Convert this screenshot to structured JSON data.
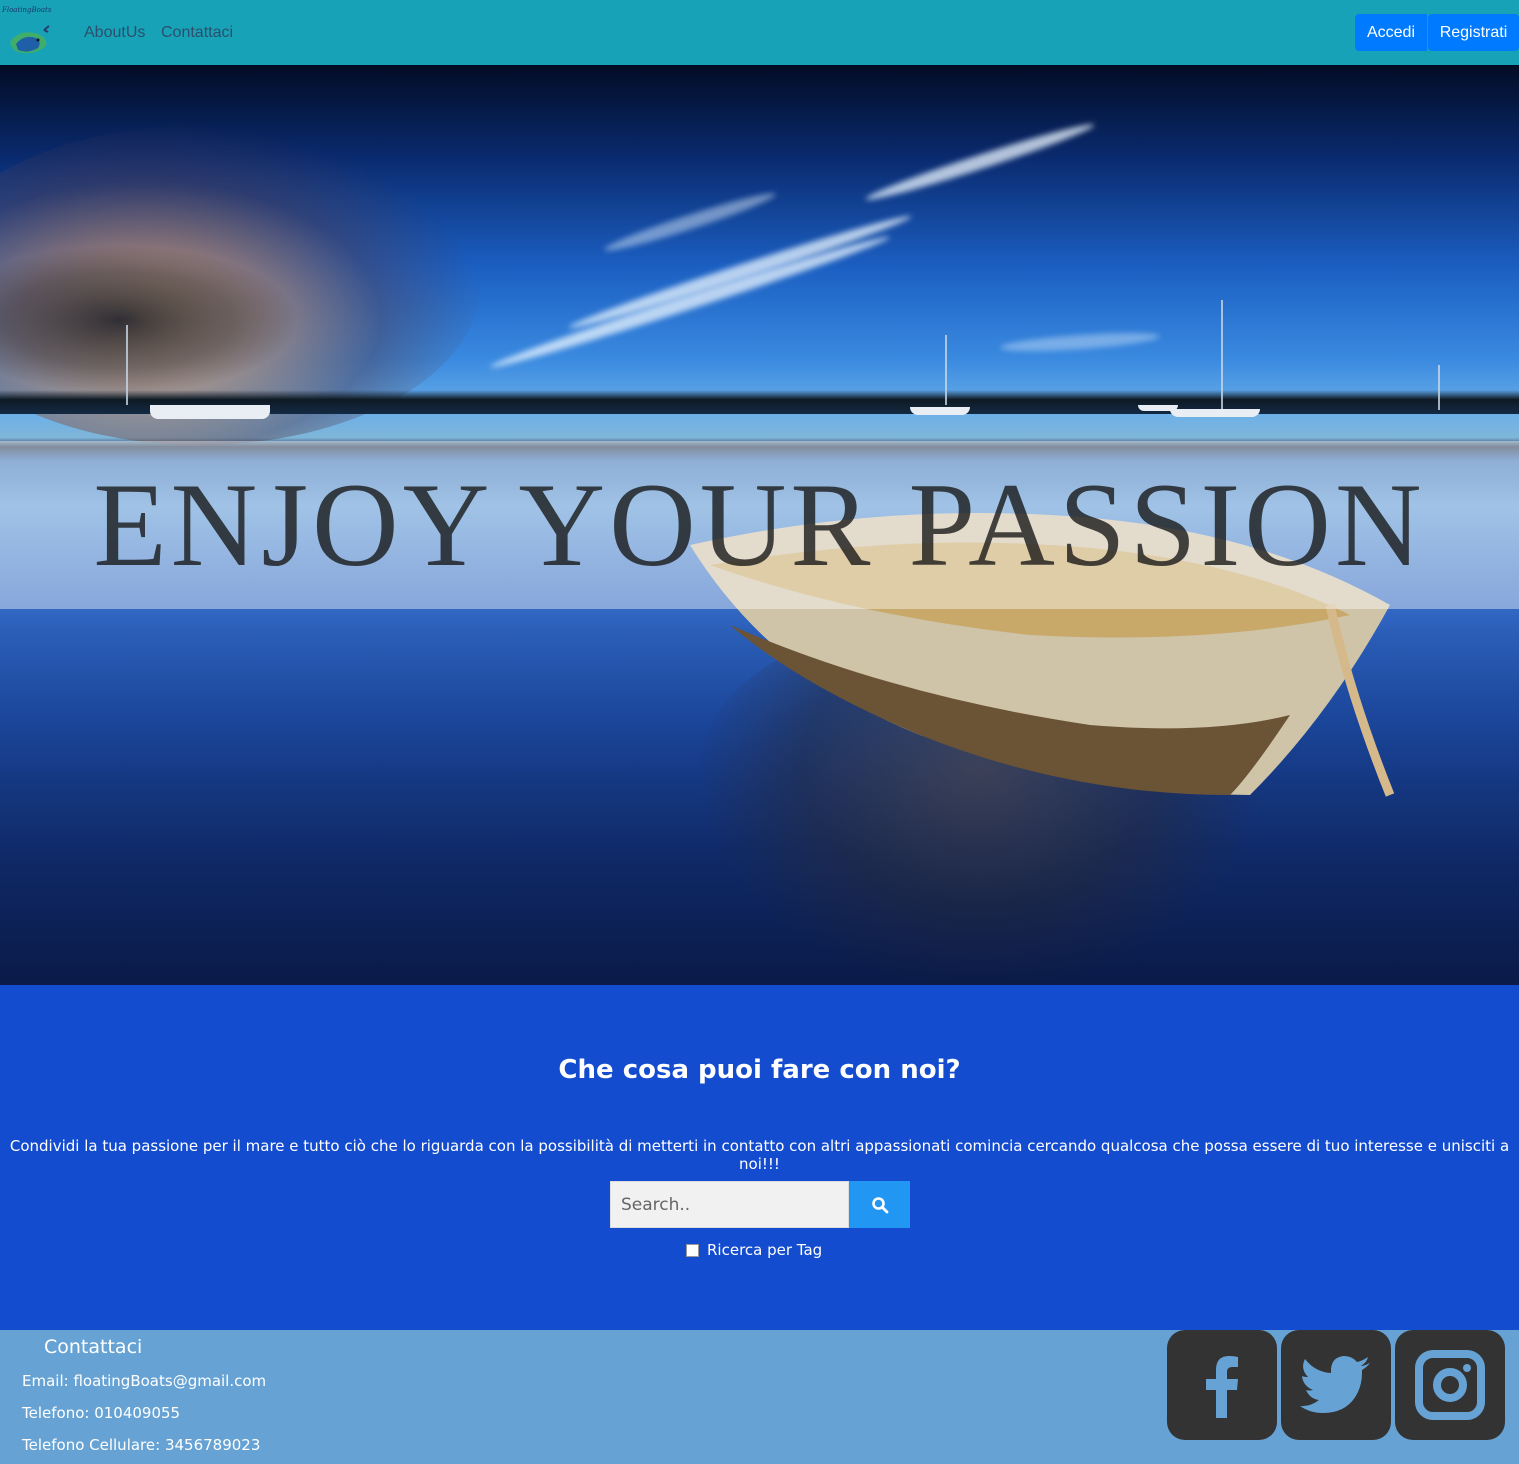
{
  "navbar": {
    "logo_text": "FloatingBoats",
    "links": [
      "AboutUs",
      "Contattaci"
    ],
    "login_label": "Accedi",
    "register_label": "Registrati"
  },
  "hero": {
    "banner_text": "ENJOY YOUR PASSION"
  },
  "main": {
    "title": "Che cosa puoi fare con noi?",
    "description": "Condividi la tua passione per il mare e tutto ciò che lo riguarda con la possibilità di metterti in contatto con altri appassionati comincia cercando qualcosa che possa essere di tuo interesse e unisciti a noi!!!",
    "search": {
      "placeholder": "Search..",
      "value": "",
      "icon": "search-icon"
    },
    "tag_search_label": "Ricerca per Tag",
    "tag_search_checked": false
  },
  "footer": {
    "title": "Contattaci",
    "email": "Email: floatingBoats@gmail.com",
    "phone": "Telefono: 010409055",
    "mobile": "Telefono Cellulare: 3456789023",
    "social": [
      "facebook-icon",
      "twitter-icon",
      "instagram-icon"
    ]
  },
  "colors": {
    "navbar": "#17a2b8",
    "button": "#007bff",
    "main_bg": "#134ccf",
    "search_button": "#2196f3",
    "footer_bg": "#66a3d4",
    "social_bg": "#333333"
  }
}
